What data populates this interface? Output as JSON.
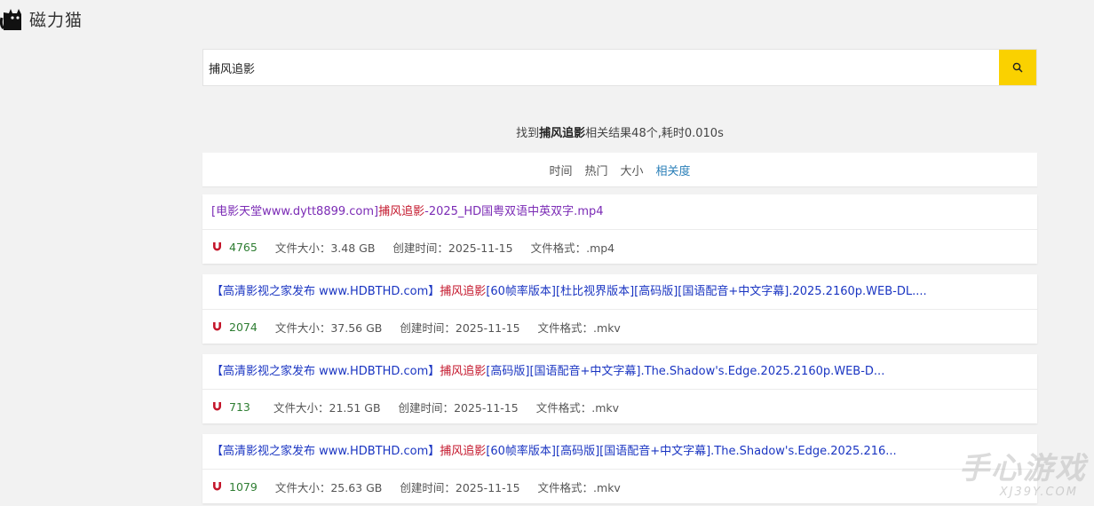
{
  "site": {
    "name": "磁力猫"
  },
  "search": {
    "value": "捕风追影",
    "button_icon": "search-icon"
  },
  "summary": {
    "prefix": "找到",
    "keyword": "捕风追影",
    "suffix": "相关结果48个,耗时0.010s"
  },
  "sort_options": [
    {
      "label": "时间",
      "active": false
    },
    {
      "label": "热门",
      "active": false
    },
    {
      "label": "大小",
      "active": false
    },
    {
      "label": "相关度",
      "active": true
    }
  ],
  "labels": {
    "size": "文件大小：",
    "created": "创建时间：",
    "format": "文件格式："
  },
  "results": [
    {
      "title_parts": [
        {
          "text": "[电影天堂www.dytt8899.com]",
          "color": "purple"
        },
        {
          "text": "捕风追影",
          "color": "red"
        },
        {
          "text": "-2025_HD国粤双语中英双字.mp4",
          "color": "purple"
        }
      ],
      "heat": "4765",
      "size": "3.48 GB",
      "created": "2025-11-15",
      "format": ".mp4"
    },
    {
      "title_parts": [
        {
          "text": "【高清影视之家发布 www.HDBTHD.com】",
          "color": "blue"
        },
        {
          "text": "捕风追影",
          "color": "red"
        },
        {
          "text": "[60帧率版本][杜比视界版本][高码版][国语配音+中文字幕].2025.2160p.WEB-DL....",
          "color": "blue"
        }
      ],
      "heat": "2074",
      "size": "37.56 GB",
      "created": "2025-11-15",
      "format": ".mkv"
    },
    {
      "title_parts": [
        {
          "text": "【高清影视之家发布 www.HDBTHD.com】",
          "color": "blue"
        },
        {
          "text": "捕风追影",
          "color": "red"
        },
        {
          "text": "[高码版][国语配音+中文字幕].The.Shadow's.Edge.2025.2160p.WEB-D...",
          "color": "blue"
        }
      ],
      "heat": "713",
      "size": "21.51 GB",
      "created": "2025-11-15",
      "format": ".mkv"
    },
    {
      "title_parts": [
        {
          "text": "【高清影视之家发布 www.HDBTHD.com】",
          "color": "blue"
        },
        {
          "text": "捕风追影",
          "color": "red"
        },
        {
          "text": "[60帧率版本][高码版][国语配音+中文字幕].The.Shadow's.Edge.2025.216...",
          "color": "blue"
        }
      ],
      "heat": "1079",
      "size": "25.63 GB",
      "created": "2025-11-15",
      "format": ".mkv"
    }
  ],
  "watermark": {
    "big": "手心游戏",
    "small": "XJ39Y.COM"
  },
  "colors": {
    "accent": "#fad100",
    "link_blue": "#1a35c2",
    "keyword_red": "#c4172c",
    "heat_green": "#2e7d32",
    "active_sort": "#2a7fb8"
  }
}
